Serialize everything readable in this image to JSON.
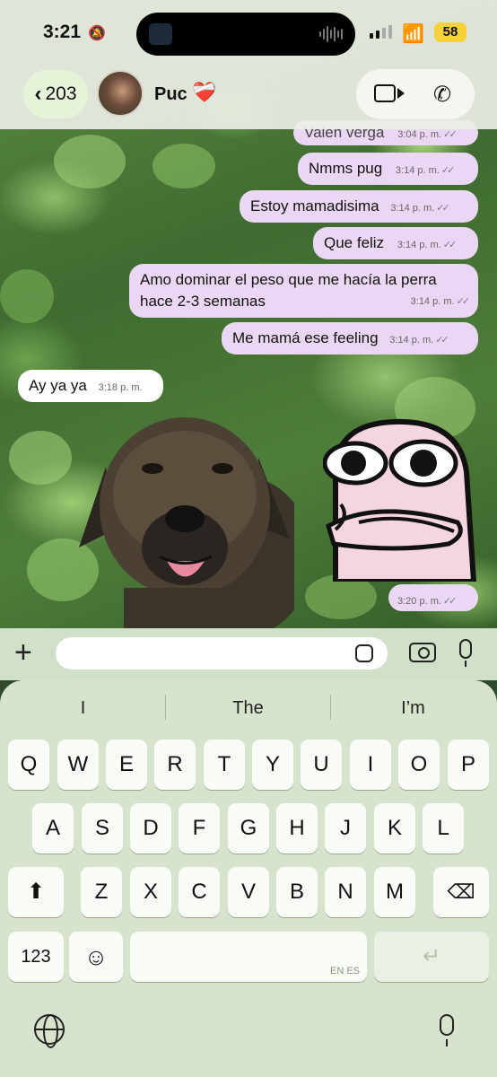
{
  "status_bar": {
    "time": "3:21",
    "battery": "58"
  },
  "header": {
    "back_count": "203",
    "contact_name": "Puc",
    "heart": "❤️‍🩹"
  },
  "messages": [
    {
      "text": "Valen verga",
      "time": "3:04 p. m."
    },
    {
      "text": "Nmms pug",
      "time": "3:14 p. m."
    },
    {
      "text": "Estoy mamadisima",
      "time": "3:14 p. m."
    },
    {
      "text": "Que feliz",
      "time": "3:14 p. m."
    },
    {
      "text": "Amo dominar el peso que me hacía la perra hace 2-3 semanas",
      "time": "3:14 p. m."
    },
    {
      "text": "Me mamá ese feeling",
      "time": "3:14 p. m."
    },
    {
      "text": "Ay ya ya",
      "time": "3:18 p. m."
    },
    {
      "text": "",
      "time": "3:20 p. m."
    }
  ],
  "composer": {
    "placeholder": ""
  },
  "keyboard": {
    "suggestions": [
      "I",
      "The",
      "I’m"
    ],
    "row1": [
      "Q",
      "W",
      "E",
      "R",
      "T",
      "Y",
      "U",
      "I",
      "O",
      "P"
    ],
    "row2": [
      "A",
      "S",
      "D",
      "F",
      "G",
      "H",
      "J",
      "K",
      "L"
    ],
    "row3": [
      "Z",
      "X",
      "C",
      "V",
      "B",
      "N",
      "M"
    ],
    "numbers_label": "123",
    "emoji": "☺",
    "lang_label": "EN ES"
  },
  "icons": {
    "back": "chevron-left-icon",
    "video": "video-camera-icon",
    "phone": "phone-icon",
    "plus": "plus-icon",
    "sticker": "sticker-icon",
    "camera": "camera-icon",
    "mic": "microphone-icon",
    "shift": "shift-icon",
    "backspace": "backspace-icon",
    "return": "return-icon",
    "globe": "globe-icon"
  },
  "colors": {
    "outgoing_bubble": "#ead7f4",
    "incoming_bubble": "#ffffff",
    "battery": "#f5d23a"
  }
}
